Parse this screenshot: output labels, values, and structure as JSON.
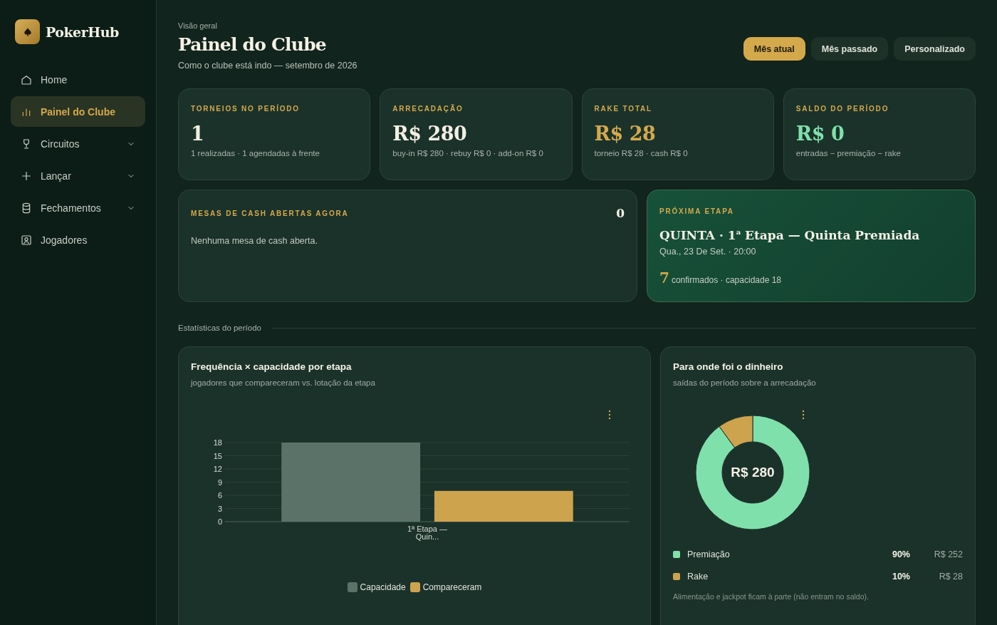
{
  "brand": {
    "name": "PokerHub"
  },
  "sidebar": {
    "items": [
      {
        "label": "Home",
        "selected": false,
        "expandable": false
      },
      {
        "label": "Painel do Clube",
        "selected": true,
        "expandable": false
      },
      {
        "label": "Circuitos",
        "selected": false,
        "expandable": true
      },
      {
        "label": "Lançar",
        "selected": false,
        "expandable": true
      },
      {
        "label": "Fechamentos",
        "selected": false,
        "expandable": true
      },
      {
        "label": "Jogadores",
        "selected": false,
        "expandable": false
      }
    ]
  },
  "header": {
    "eyebrow": "Visão geral",
    "title": "Painel do Clube",
    "subtitle": "Como o clube está indo — setembro de 2026"
  },
  "period_buttons": [
    {
      "label": "Mês atual",
      "selected": true
    },
    {
      "label": "Mês passado",
      "selected": false
    },
    {
      "label": "Personalizado",
      "selected": false
    }
  ],
  "kpis": [
    {
      "label": "TORNEIOS NO PERÍODO",
      "value": "1",
      "color": "#f3efe3",
      "detail": "1 realizadas · 1 agendadas à frente"
    },
    {
      "label": "ARRECADAÇÃO",
      "value": "R$ 280",
      "color": "#f3efe3",
      "detail": "buy-in R$ 280 · rebuy R$ 0 · add-on R$ 0"
    },
    {
      "label": "RAKE TOTAL",
      "value": "R$ 28",
      "color": "#d4a94c",
      "detail": "torneio R$ 28 · cash R$ 0"
    },
    {
      "label": "SALDO DO PERÍODO",
      "value": "R$ 0",
      "color": "#7fe0ab",
      "detail": "entradas − premiação − rake"
    }
  ],
  "cash_tables": {
    "label": "MESAS DE CASH ABERTAS AGORA",
    "count": "0",
    "empty_message": "Nenhuma mesa de cash aberta."
  },
  "next_stage": {
    "label": "PRÓXIMA ETAPA",
    "title": "QUINTA · 1$^{a}$ Etapa — Quinta Premiada",
    "when": "Qua., 23 De Set. · 20:00",
    "confirmed": "7",
    "confirmed_text": "confirmados · capacidade 18"
  },
  "section_label": "Estatísticas do período",
  "attendance_card": {
    "title": "Frequência × capacidade por etapa",
    "subtitle": "jogadores que compareceram vs. lotação da etapa",
    "chart_data": {
      "type": "bar",
      "categories": [
        "1ª Etapa — Quin..."
      ],
      "series": [
        {
          "name": "Capacidade",
          "color": "#5b7268",
          "values": [
            18
          ]
        },
        {
          "name": "Compareceram",
          "color": "#cda34e",
          "values": [
            7
          ]
        }
      ],
      "ylim": [
        0,
        18
      ],
      "yticks": [
        0,
        3,
        6,
        9,
        12,
        15,
        18
      ],
      "grid": true,
      "legend": "bottom"
    }
  },
  "money_card": {
    "title": "Para onde foi o dinheiro",
    "subtitle": "saídas do período sobre a arrecadação",
    "center_label": "R$ 280",
    "chart_data": {
      "type": "donut",
      "categories": [
        "Premiação",
        "Rake"
      ],
      "values": [
        90,
        10
      ],
      "colors": [
        "#7fe0ab",
        "#cda34e"
      ]
    },
    "legend": [
      {
        "color": "#7fe0ab",
        "percent": "90%",
        "amount": "R$ 252"
      },
      {
        "color": "#cda34e",
        "percent": "10%",
        "amount": "R$ 28"
      }
    ],
    "footnote": "Alimentação e jackpot ficam à parte (não entram no saldo)."
  }
}
